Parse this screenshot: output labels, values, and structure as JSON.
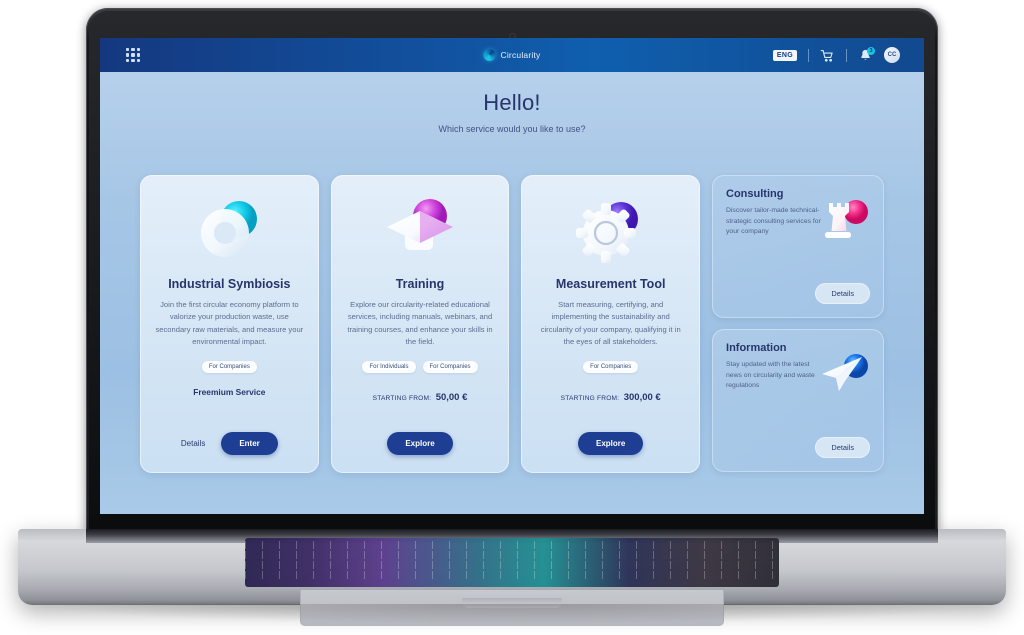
{
  "header": {
    "menu_icon": "grid-menu-icon",
    "brand_name": "Circularity",
    "language": "ENG",
    "cart_icon": "cart-icon",
    "bell_icon": "bell-icon",
    "notification_count": "3",
    "avatar_initials": "CC"
  },
  "hero": {
    "title": "Hello!",
    "subtitle": "Which service would you like to use?"
  },
  "cards": [
    {
      "icon": "ring-torus-icon",
      "title": "Industrial Symbiosis",
      "description": "Join the first circular economy platform to valorize your production waste, use secondary raw materials, and measure your environmental impact.",
      "tags": [
        "For Companies"
      ],
      "plan": "Freemium Service",
      "details_label": "Details",
      "action_label": "Enter"
    },
    {
      "icon": "graduation-cap-icon",
      "title": "Training",
      "description": "Explore our circularity-related educational services, including manuals, webinars, and training courses, and enhance your skills in the field.",
      "tags": [
        "For Individuals",
        "For Companies"
      ],
      "price_label": "STARTING FROM:",
      "price_value": "50,00 €",
      "action_label": "Explore"
    },
    {
      "icon": "gear-icon",
      "title": "Measurement Tool",
      "description": "Start measuring, certifying, and implementing the sustainability and circularity of your company, qualifying it in the eyes of all stakeholders.",
      "tags": [
        "For Companies"
      ],
      "price_label": "STARTING FROM:",
      "price_value": "300,00 €",
      "action_label": "Explore"
    }
  ],
  "side_cards": [
    {
      "icon": "chess-rook-icon",
      "title": "Consulting",
      "description": "Discover tailor-made technical-strategic consulting services for your company",
      "details_label": "Details"
    },
    {
      "icon": "paper-plane-icon",
      "title": "Information",
      "description": "Stay updated with the latest news on circularity and waste regulations",
      "details_label": "Details"
    }
  ],
  "colors": {
    "header_blue": "#12519e",
    "primary_button": "#1d3e93",
    "title_navy": "#27356b",
    "page_bg": "#a6c6e6",
    "card_bg": "#dce8f6",
    "accent_teal": "#1ec8e0",
    "accent_magenta": "#c23fd6",
    "accent_violet": "#5b34d6",
    "accent_pink": "#f52f8b"
  }
}
